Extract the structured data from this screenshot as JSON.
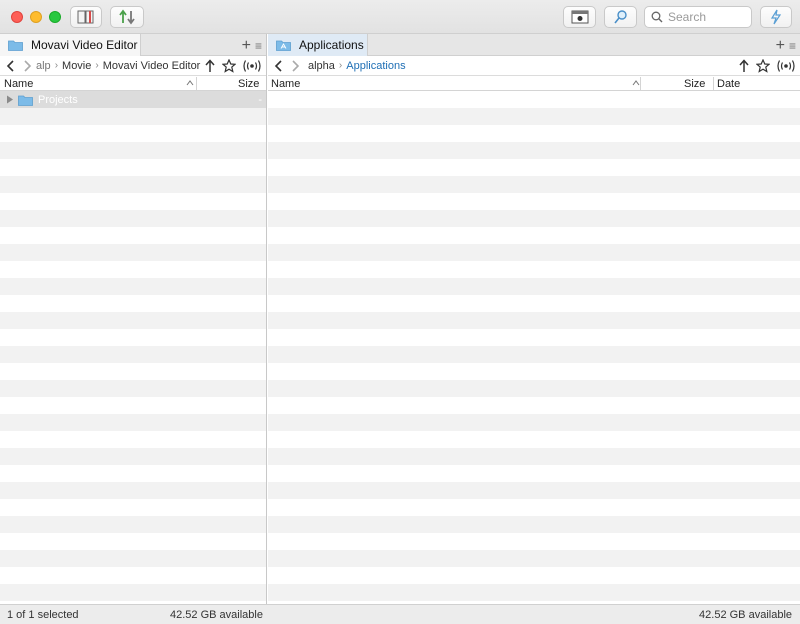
{
  "toolbar": {
    "search_placeholder": "Search",
    "icons": [
      "book-icon",
      "sync-arrows-icon",
      "preview-icon",
      "find-icon",
      "search-icon",
      "lightning-icon"
    ]
  },
  "left_pane": {
    "tab_title": "Movavi Video Editor",
    "breadcrumbs": [
      "alp",
      "Movie",
      "Movavi Video Editor"
    ],
    "columns": {
      "name": "Name",
      "size": "Size"
    },
    "rows": [
      {
        "name": "Projects",
        "size": "-",
        "selected": true
      }
    ]
  },
  "right_pane": {
    "tab_title": "Applications",
    "breadcrumbs": [
      "alpha",
      "Applications"
    ],
    "columns": {
      "name": "Name",
      "size": "Size",
      "date": "Date"
    },
    "rows": []
  },
  "status": {
    "left_selection": "1 of 1 selected",
    "left_available": "42.52 GB available",
    "right_available": "42.52 GB available"
  },
  "colors": {
    "folder": "#7cbbe8",
    "accent": "#1f6fb5",
    "row_stripe": "#f2f2f2"
  }
}
